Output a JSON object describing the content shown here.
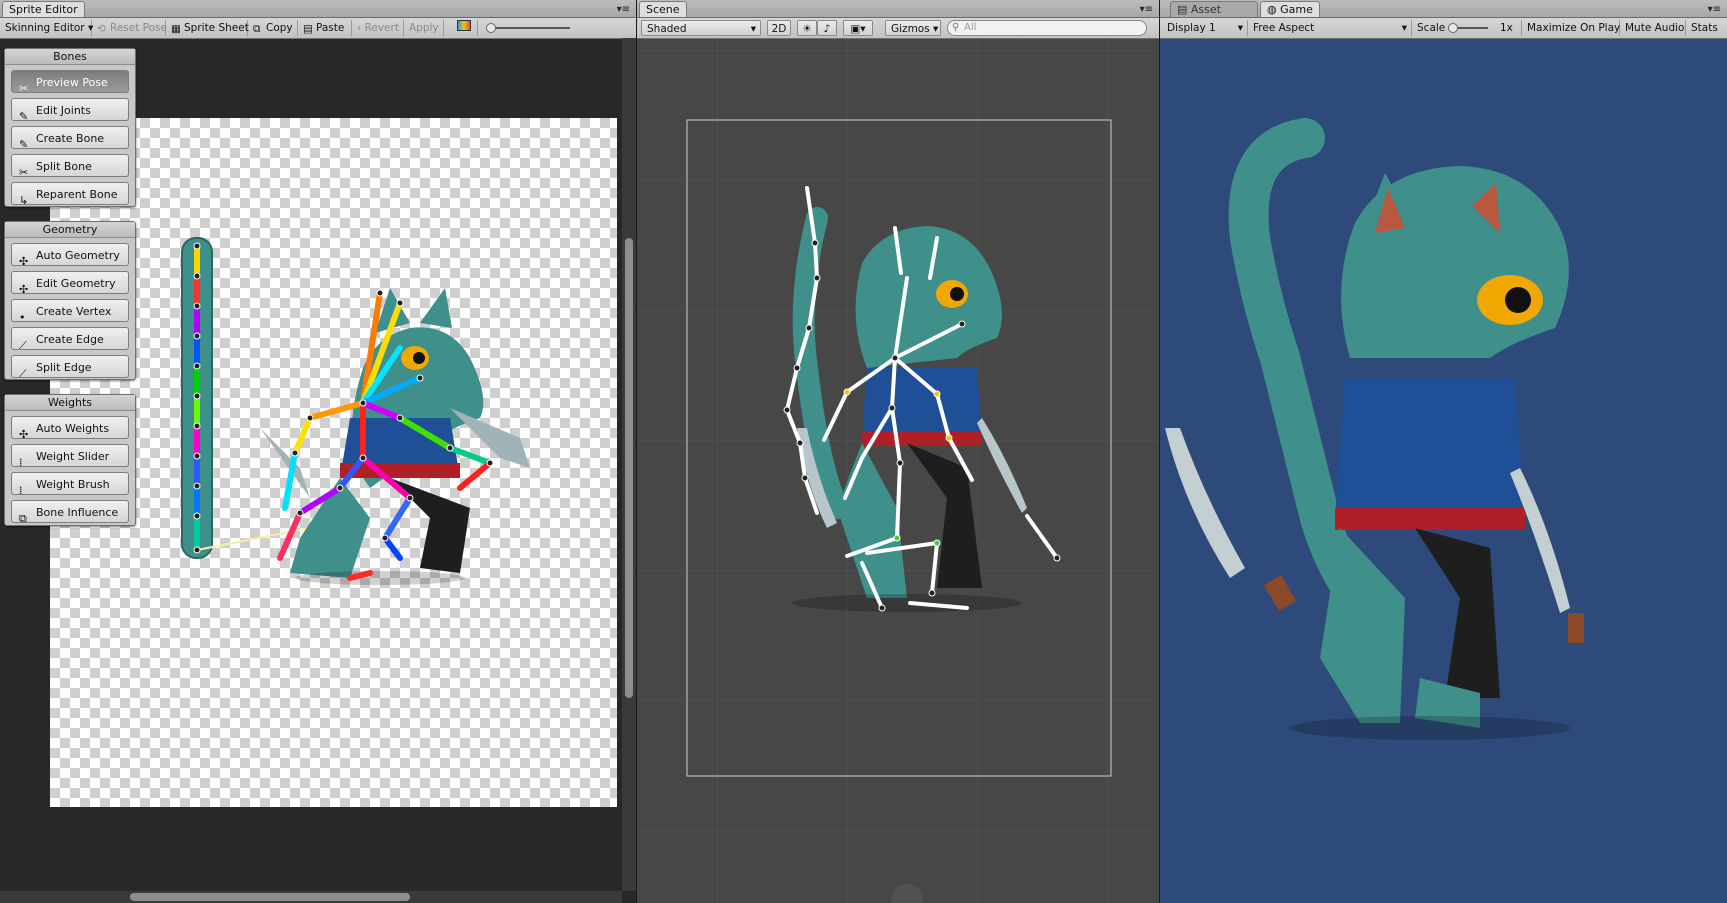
{
  "sprite_editor": {
    "tab_label": "Sprite Editor",
    "toolbar": {
      "mode": "Skinning Editor",
      "reset_pose": "Reset Pose",
      "sprite_sheet": "Sprite Sheet",
      "copy": "Copy",
      "paste": "Paste",
      "revert": "Revert",
      "apply": "Apply"
    },
    "groups": [
      {
        "title": "Bones",
        "items": [
          "Preview Pose",
          "Edit Joints",
          "Create Bone",
          "Split Bone",
          "Reparent Bone"
        ],
        "selected": "Preview Pose"
      },
      {
        "title": "Geometry",
        "items": [
          "Auto Geometry",
          "Edit Geometry",
          "Create Vertex",
          "Create Edge",
          "Split Edge"
        ]
      },
      {
        "title": "Weights",
        "items": [
          "Auto Weights",
          "Weight Slider",
          "Weight Brush",
          "Bone Influence"
        ]
      }
    ]
  },
  "scene": {
    "tab_label": "Scene",
    "shading": "Shaded",
    "mode_2d": "2D",
    "gizmos": "Gizmos",
    "search_placeholder": "All"
  },
  "asset_store_tab": "Asset Store",
  "game": {
    "tab_label": "Game",
    "display": "Display 1",
    "aspect": "Free Aspect",
    "scale_label": "Scale",
    "scale_value": "1x",
    "maximize": "Maximize On Play",
    "mute": "Mute Audio",
    "stats": "Stats"
  },
  "colors": {
    "game_bg": "#2e4a7b",
    "scene_bg": "#474747",
    "cat_body": "#3f8f8a",
    "vest": "#1f4f96",
    "sash": "#b01f27"
  }
}
